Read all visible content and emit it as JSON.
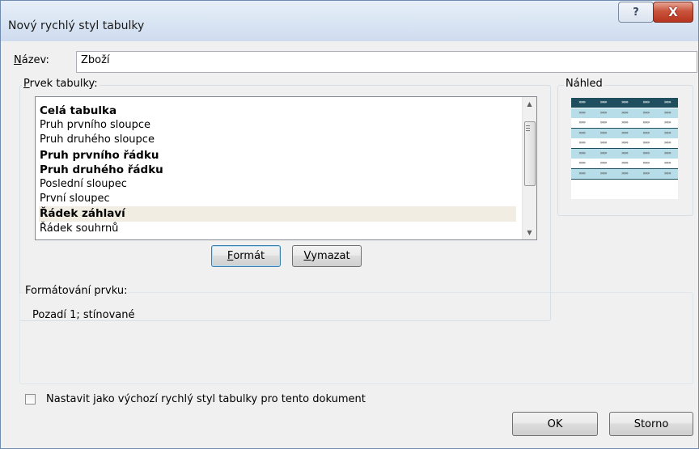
{
  "window": {
    "title": "Nový rychlý styl tabulky",
    "help_glyph": "?",
    "close_glyph": "X"
  },
  "name_field": {
    "label_underlined": "N",
    "label_rest": "ázev:",
    "value": "Zboží"
  },
  "table_element": {
    "label_underlined": "P",
    "label_rest": "rvek tabulky:",
    "items": [
      {
        "label": "Celá tabulka",
        "bold": true,
        "selected": false
      },
      {
        "label": "Pruh prvního sloupce",
        "bold": false,
        "selected": false
      },
      {
        "label": "Pruh druhého sloupce",
        "bold": false,
        "selected": false
      },
      {
        "label": "Pruh prvního řádku",
        "bold": true,
        "selected": false
      },
      {
        "label": "Pruh druhého řádku",
        "bold": true,
        "selected": false
      },
      {
        "label": "Poslední sloupec",
        "bold": false,
        "selected": false
      },
      {
        "label": "První sloupec",
        "bold": false,
        "selected": false
      },
      {
        "label": "Řádek záhlaví",
        "bold": true,
        "selected": true
      },
      {
        "label": "Řádek souhrnů",
        "bold": false,
        "selected": false
      }
    ],
    "format_button": {
      "underlined": "F",
      "rest": "ormát"
    },
    "clear_button": {
      "underlined": "V",
      "rest": "ymazat"
    }
  },
  "preview": {
    "label": "Náhled",
    "cell_glyph": "»»»",
    "colors": {
      "header": "#1f4e5f",
      "band": "#b7dde8",
      "line": "#1f4e5f"
    }
  },
  "element_formatting": {
    "label": "Formátování prvku:",
    "description": "Pozadí 1; stínované"
  },
  "default_checkbox": {
    "label_before": "Nastavit ",
    "label_underlined": "j",
    "label_after": "ako výchozí rychlý styl tabulky pro tento dokument",
    "checked": false
  },
  "footer": {
    "ok_label": "OK",
    "cancel_label": "Storno"
  }
}
